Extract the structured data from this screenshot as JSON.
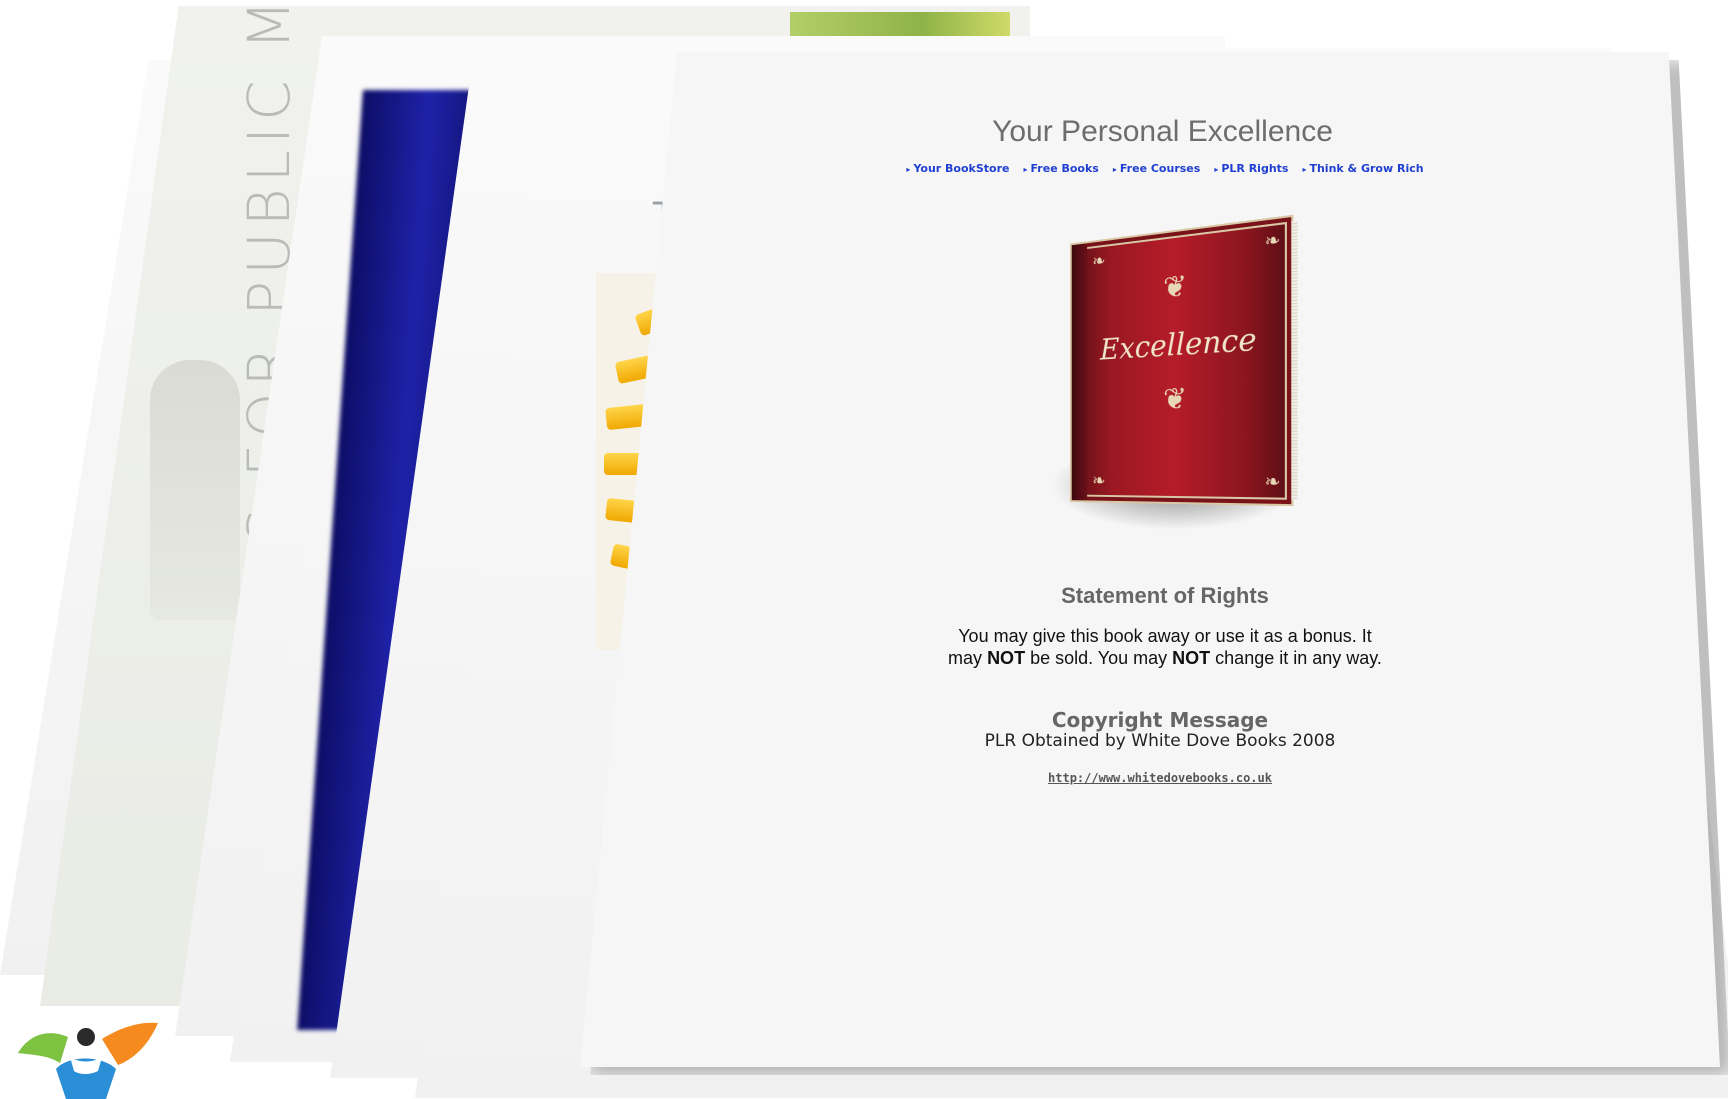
{
  "background_pages": {
    "vertical_title": "SOFT SKILLS FOR PUBLIC MANAGERS",
    "partial_title": "Tim"
  },
  "front_page": {
    "title": "Your Personal Excellence",
    "nav": [
      {
        "label": "Your BookStore"
      },
      {
        "label": "Free Books"
      },
      {
        "label": "Free Courses"
      },
      {
        "label": "PLR Rights"
      },
      {
        "label": "Think & Grow Rich"
      }
    ],
    "book_cover_text": "Excellence",
    "rights": {
      "heading": "Statement of Rights",
      "line1": "You may give this book away or use it as a bonus. It",
      "line2_pre": "may ",
      "line2_bold1": "NOT",
      "line2_mid": " be sold. You may ",
      "line2_bold2": "NOT",
      "line2_post": " change it in any way."
    },
    "copyright": {
      "heading": "Copyright Message",
      "line": "PLR Obtained by White Dove Books 2008",
      "url": "http://www.whitedovebooks.co.uk"
    }
  },
  "colors": {
    "nav_link": "#1f3fd1",
    "book_red": "#b51c28",
    "spine_blue": "#1e22a8",
    "logo_green": "#7ec242",
    "logo_blue": "#2a8fd6",
    "logo_orange": "#f58a1f"
  }
}
